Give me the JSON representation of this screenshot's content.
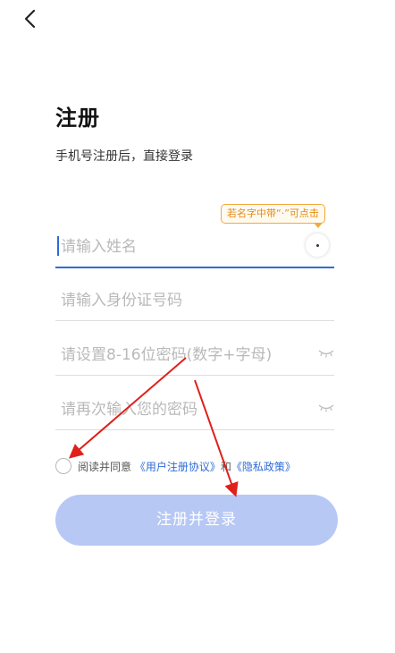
{
  "header": {
    "back_icon": "chevron-left-icon"
  },
  "page": {
    "title": "注册",
    "subtitle": "手机号注册后，直接登录"
  },
  "tooltip": {
    "text": "若名字中带“·”可点击"
  },
  "form": {
    "name": {
      "placeholder": "请输入姓名",
      "value": ""
    },
    "id_number": {
      "placeholder": "请输入身份证号码",
      "value": ""
    },
    "password": {
      "placeholder": "请设置8-16位密码(数字+字母)",
      "value": ""
    },
    "password_confirm": {
      "placeholder": "请再次输入您的密码",
      "value": ""
    }
  },
  "agreement": {
    "prefix": "阅读并同意",
    "user_agreement": "《用户注册协议》",
    "and": "和",
    "privacy_policy": "《隐私政策》",
    "checked": false
  },
  "submit": {
    "label": "注册并登录"
  },
  "colors": {
    "accent": "#2f6bd8",
    "button_disabled": "#b7c8f5",
    "tooltip": "#f3a93b",
    "annotation_arrow": "#e0201b"
  }
}
